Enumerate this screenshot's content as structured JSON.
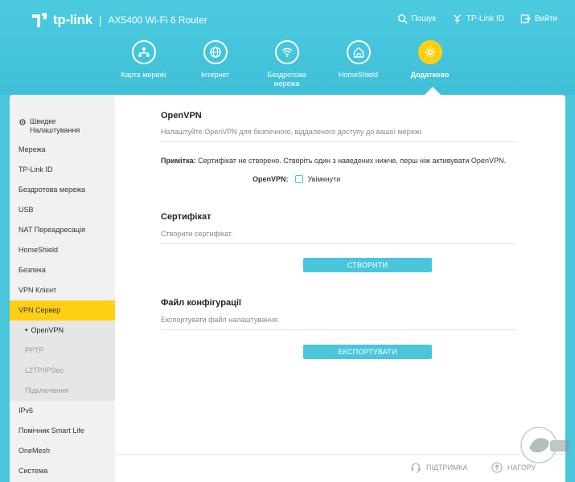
{
  "brand": {
    "logo_text": "tp-link",
    "separator": "|",
    "model": "AX5400 Wi-Fi 6 Router"
  },
  "top_links": {
    "search": "Пошук",
    "tplink_id": "TP-Link ID",
    "logout": "Вийти"
  },
  "nav": [
    {
      "label": "Карта мережі",
      "icon": "network-map-icon"
    },
    {
      "label": "Інтернет",
      "icon": "globe-icon"
    },
    {
      "label": "Бездротова мережа",
      "icon": "wifi-icon"
    },
    {
      "label": "HomeShield",
      "icon": "home-shield-icon"
    },
    {
      "label": "Додатково",
      "icon": "gear-icon",
      "active": true
    }
  ],
  "sidebar": {
    "quick_setup": "Швидке Налаштування",
    "items": [
      "Мережа",
      "TP-Link ID",
      "Бездротова мережа",
      "USB",
      "NAT Переадресація",
      "HomeShield",
      "Безпека",
      "VPN Клієнт",
      "VPN Сервер"
    ],
    "sub_items": [
      "OpenVPN",
      "PPTP",
      "L2TP/IPSec",
      "Підключення"
    ],
    "items_after": [
      "IPv6",
      "Помічник Smart Life",
      "OneMesh",
      "Система"
    ]
  },
  "openvpn": {
    "title": "OpenVPN",
    "desc": "Налаштуйте OpenVPN для безпечного, віддаленого доступу до вашої мережі.",
    "note_label": "Примітка:",
    "note_text": " Сертифікат не створено. Створіть один з наведених нижче, перш ніж активувати OpenVPN.",
    "toggle_label": "OpenVPN:",
    "enable_label": "Увімкнути"
  },
  "certificate": {
    "title": "Сертифікат",
    "desc": "Створити сертифікат.",
    "button": "СТВОРИТИ"
  },
  "config_file": {
    "title": "Файл конфігурації",
    "desc": "Експортувати файл налаштування.",
    "button": "ЕКСПОРТУВАТИ"
  },
  "footer": {
    "support": "ПІДТРИМКА",
    "back_to_top": "НАГОРУ"
  },
  "colors": {
    "header": "#4ac6dc",
    "accent": "#ffd012",
    "button": "#4ac6dc"
  }
}
